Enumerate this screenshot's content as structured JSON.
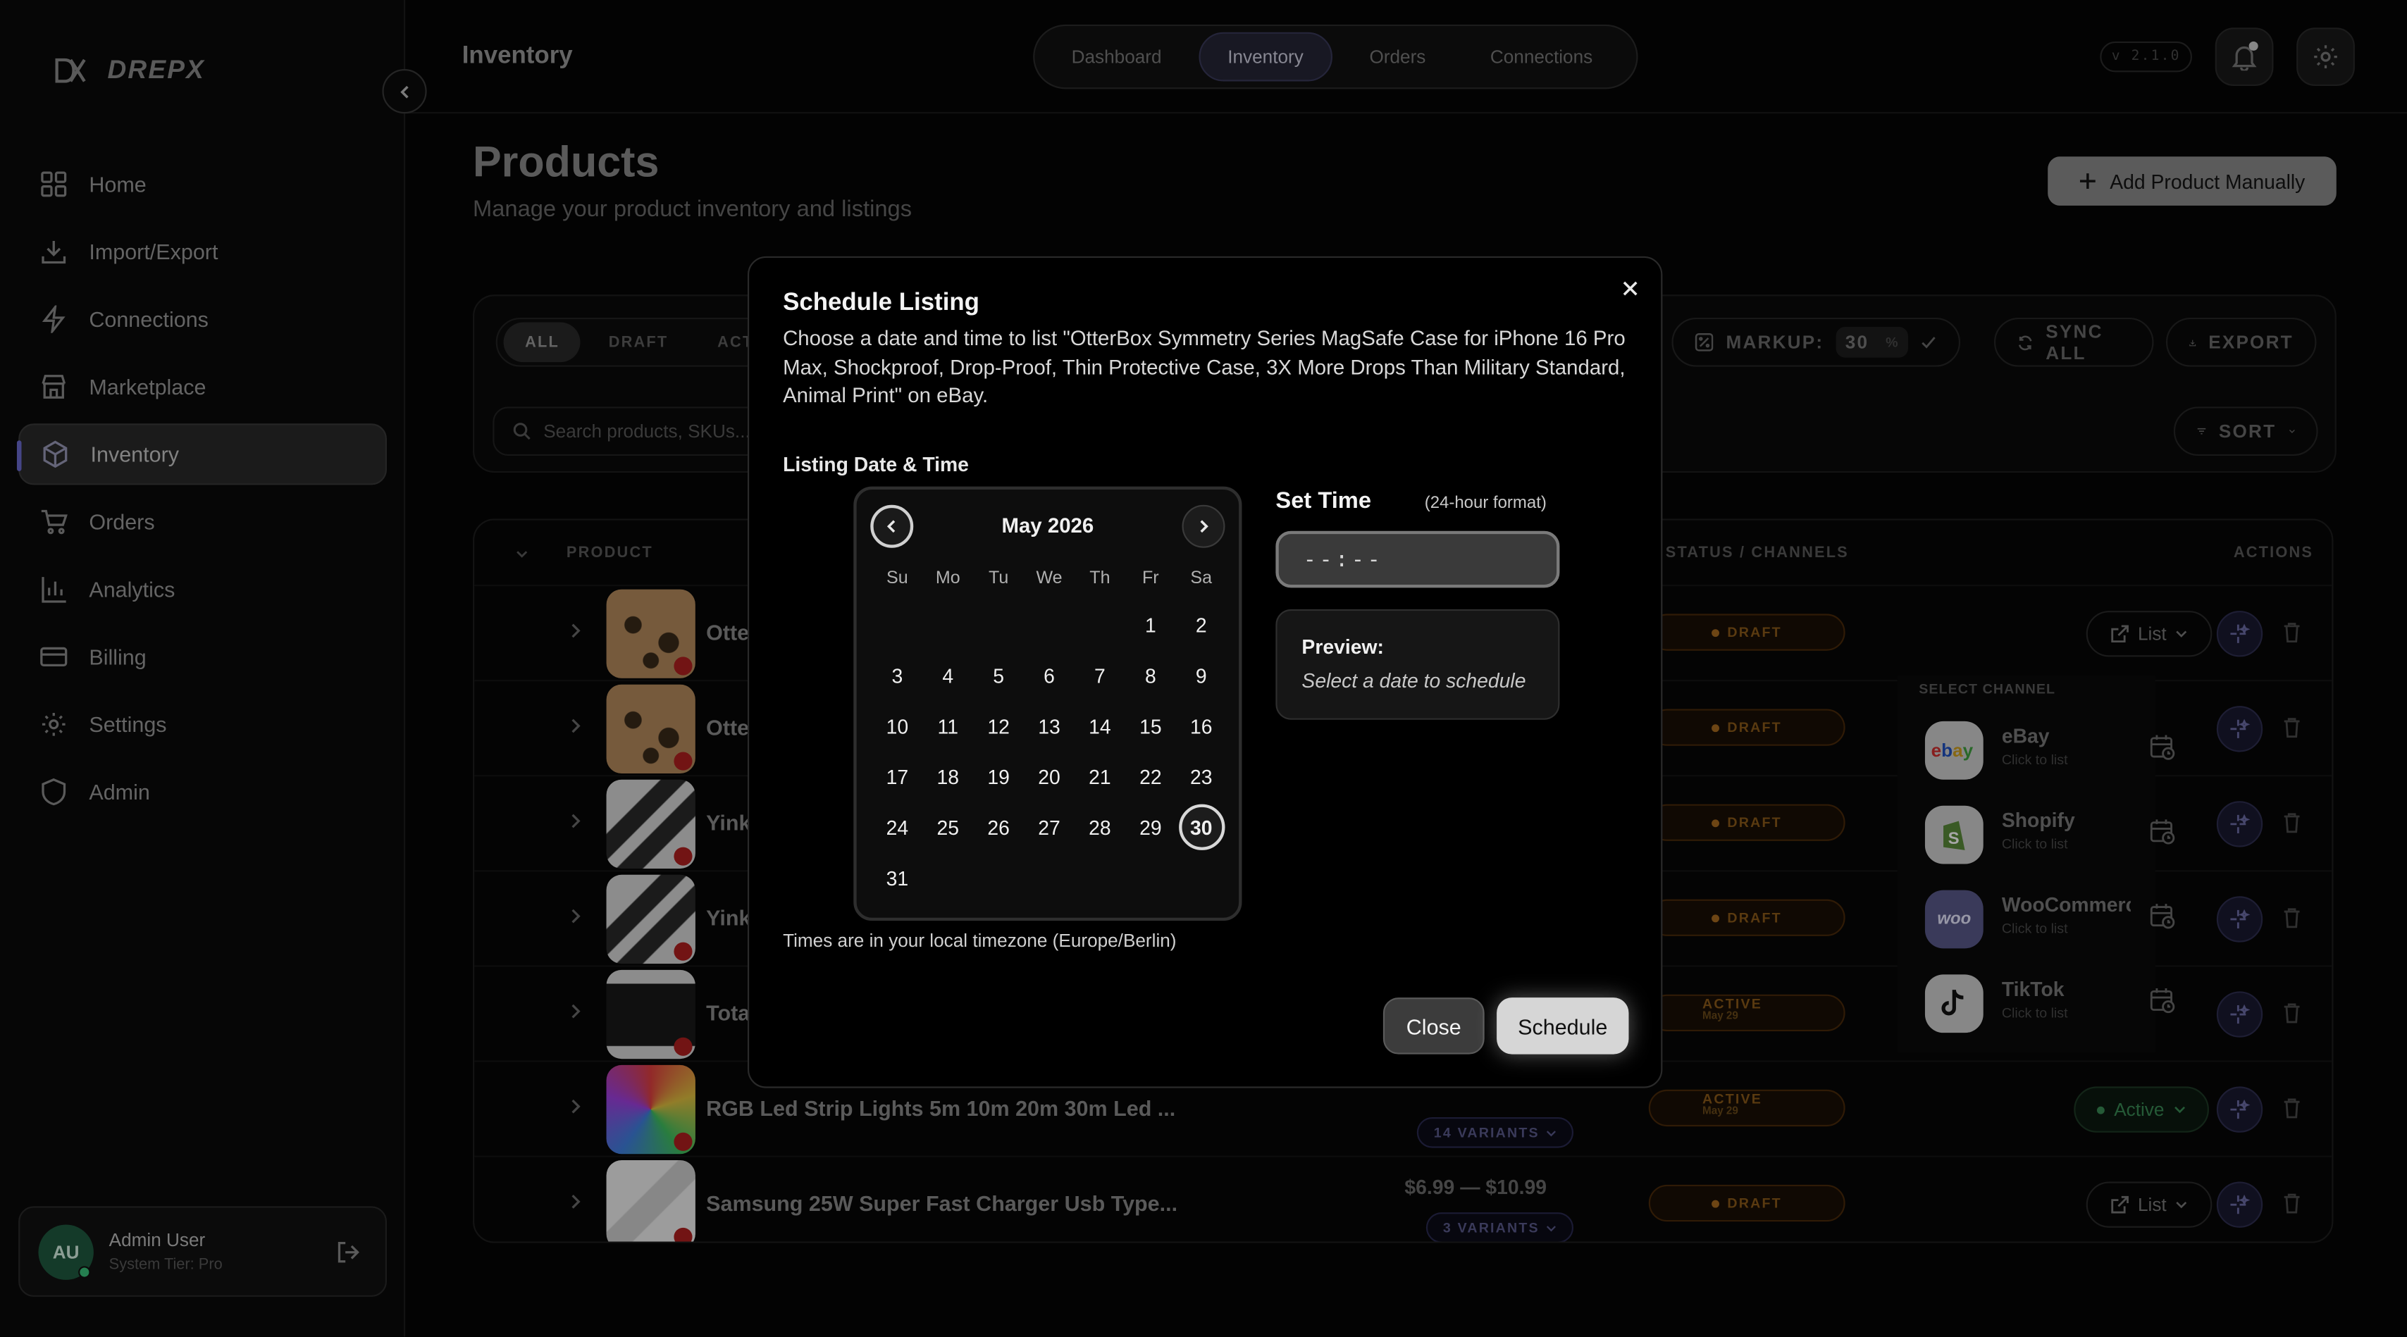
{
  "app": {
    "logo_text": "DREPX",
    "version": "v 2.1.0"
  },
  "sidebar": {
    "items": [
      {
        "label": "Home",
        "icon": "grid-icon"
      },
      {
        "label": "Import/Export",
        "icon": "download-icon"
      },
      {
        "label": "Connections",
        "icon": "bolt-icon"
      },
      {
        "label": "Marketplace",
        "icon": "store-icon"
      },
      {
        "label": "Inventory",
        "icon": "box-icon",
        "active": true
      },
      {
        "label": "Orders",
        "icon": "cart-icon"
      },
      {
        "label": "Analytics",
        "icon": "chart-icon"
      },
      {
        "label": "Billing",
        "icon": "card-icon"
      },
      {
        "label": "Settings",
        "icon": "gear-icon"
      },
      {
        "label": "Admin",
        "icon": "shield-icon"
      }
    ],
    "user": {
      "initials": "AU",
      "name": "Admin User",
      "tier": "System Tier: Pro"
    }
  },
  "header": {
    "title": "Inventory",
    "tabs": [
      "Dashboard",
      "Inventory",
      "Orders",
      "Connections"
    ],
    "active_tab": "Inventory"
  },
  "page": {
    "title": "Products",
    "subtitle": "Manage your product inventory and listings",
    "add_button": "Add Product Manually"
  },
  "toolbar": {
    "filters": [
      "ALL",
      "DRAFT",
      "ACTIVE"
    ],
    "search_placeholder": "Search products, SKUs...",
    "markup_label": "MARKUP:",
    "markup_value": "30",
    "markup_unit": "%",
    "sync_label": "SYNC ALL",
    "export_label": "EXPORT",
    "sort_label": "SORT"
  },
  "table": {
    "headers": {
      "product": "PRODUCT",
      "status": "STATUS / CHANNELS",
      "actions": "ACTIONS"
    },
    "rows": [
      {
        "name": "Otte",
        "status": "DRAFT",
        "action": "List"
      },
      {
        "name": "Otte",
        "status": "DRAFT"
      },
      {
        "name": "Yink",
        "status": "DRAFT"
      },
      {
        "name": "Yink",
        "status": "DRAFT"
      },
      {
        "name": "Tota",
        "status": "ACTIVE",
        "status_sub": "May 29"
      },
      {
        "name": "RGB Led Strip Lights 5m 10m 20m 30m Led ...",
        "status": "ACTIVE",
        "status_sub": "May 29",
        "variants": "14 VARIANTS",
        "action": "Active"
      },
      {
        "name": "Samsung 25W Super Fast Charger Usb Type...",
        "status": "DRAFT",
        "price_low": "$6.99",
        "price_high": "$10.99",
        "price_sep": "—",
        "variants": "3 VARIANTS",
        "action": "List"
      }
    ]
  },
  "channel_panel": {
    "title": "SELECT CHANNEL",
    "channels": [
      {
        "name": "eBay",
        "sub": "Click to list"
      },
      {
        "name": "Shopify",
        "sub": "Click to list"
      },
      {
        "name": "WooCommerce",
        "sub": "Click to list",
        "logo_text": "woo"
      },
      {
        "name": "TikTok",
        "sub": "Click to list"
      }
    ]
  },
  "modal": {
    "title": "Schedule Listing",
    "description": "Choose a date and time to list \"OtterBox Symmetry Series MagSafe Case for iPhone 16 Pro Max, Shockproof, Drop-Proof, Thin Protective Case, 3X More Drops Than Military Standard, Animal Print\" on eBay.",
    "section_label": "Listing Date & Time",
    "calendar": {
      "month_label": "May 2026",
      "weekdays": [
        "Su",
        "Mo",
        "Tu",
        "We",
        "Th",
        "Fr",
        "Sa"
      ],
      "first_weekday_index": 5,
      "days_in_month": 31,
      "highlighted_day": 30
    },
    "timezone_note": "Times are in your local timezone (Europe/Berlin)",
    "set_time_label": "Set Time",
    "time_format_note": "(24-hour format)",
    "time_placeholder": "--:--",
    "preview_label": "Preview:",
    "preview_value": "Select a date to schedule",
    "close_label": "Close",
    "schedule_label": "Schedule"
  },
  "colors": {
    "accent": "#6b6bd0",
    "draft": "#a86a20",
    "active_green": "#3a8a55"
  }
}
